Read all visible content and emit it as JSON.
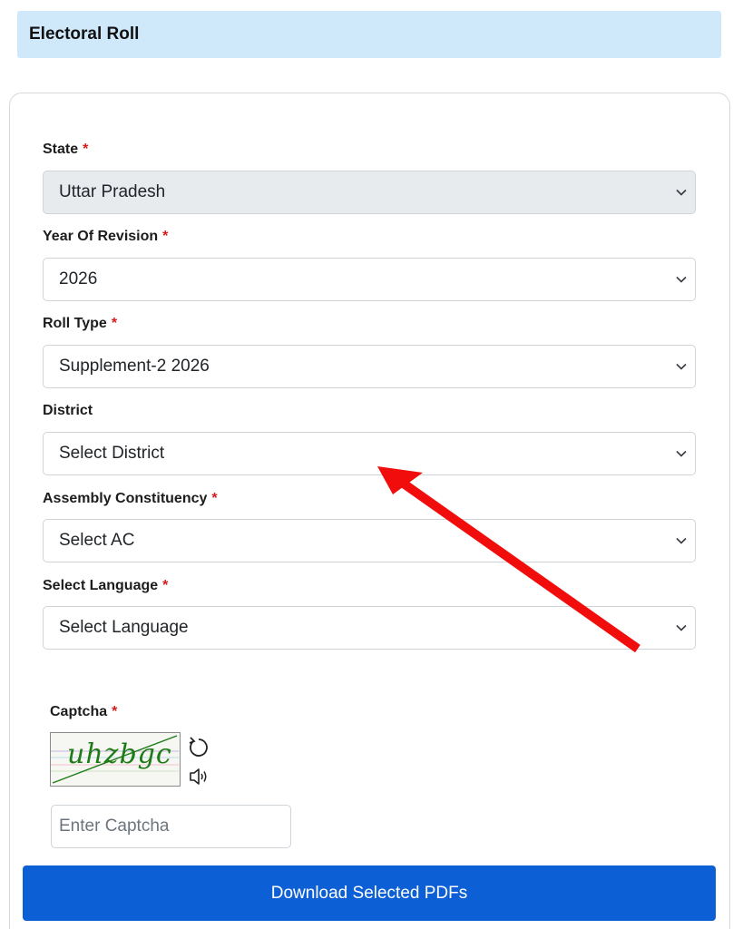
{
  "header": {
    "title": "Electoral Roll"
  },
  "form": {
    "required_mark": "*",
    "state": {
      "label": "State",
      "value": "Uttar Pradesh",
      "required": true,
      "disabled": true
    },
    "year": {
      "label": "Year Of Revision",
      "value": "2026",
      "required": true
    },
    "roll_type": {
      "label": "Roll Type",
      "value": "Supplement-2 2026",
      "required": true
    },
    "district": {
      "label": "District",
      "value": "Select District",
      "required": false
    },
    "assembly": {
      "label": "Assembly Constituency",
      "value": "Select AC",
      "required": true
    },
    "language": {
      "label": "Select Language",
      "value": "Select Language",
      "required": true
    }
  },
  "captcha": {
    "label": "Captcha",
    "image_text": "uhzbgc",
    "input_placeholder": "Enter Captcha",
    "refresh_icon": "refresh-icon",
    "audio_icon": "speaker-icon"
  },
  "actions": {
    "download_label": "Download Selected PDFs"
  },
  "colors": {
    "header_bg": "#cfe9fb",
    "primary": "#0d5fd6",
    "required": "#d81b1b",
    "annotation_arrow": "#f20d0d"
  }
}
